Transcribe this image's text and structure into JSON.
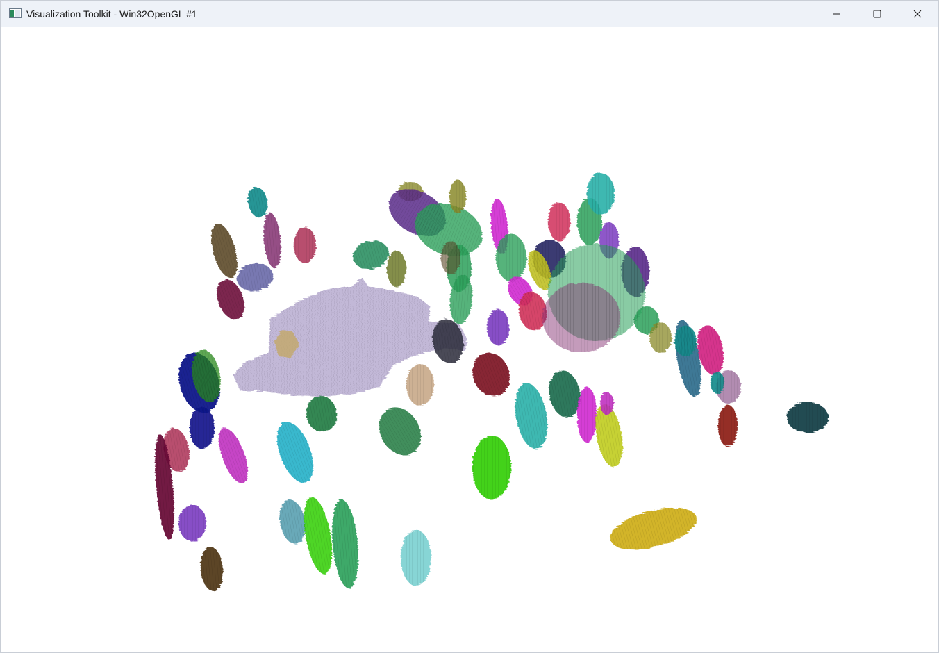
{
  "window": {
    "title": "Visualization Toolkit - Win32OpenGL #1",
    "background": "#ffffff",
    "titlebar_color": "#eef2f8"
  },
  "controls": {
    "minimize_icon": "minimize-icon",
    "maximize_icon": "maximize-icon",
    "close_icon": "close-icon"
  },
  "scene": {
    "description_type": "3d-render",
    "main_body_color": "#b7abd0",
    "palette": [
      "#138a8a",
      "#5c4a2a",
      "#8a3a78",
      "#b03a5e",
      "#6a6aa8",
      "#6e0d3c",
      "#1c8a5a",
      "#6e7a2a",
      "#8a8a2a",
      "#5a2a8a",
      "#2aa05a",
      "#d02ad0",
      "#1a1a5a",
      "#c0c022",
      "#d0305a",
      "#2ab0a8",
      "#7a3ac0",
      "#7a1020",
      "#c8a888",
      "#2a2a3a",
      "#1e7a40",
      "#22b0c8",
      "#10138a",
      "#2a8a1a",
      "#3ad010",
      "#1a6a4a",
      "#c0cc20",
      "#c030c0",
      "#6a0a3a",
      "#4a3010",
      "#5aa0b0",
      "#7ad0d0",
      "#d0b020",
      "#14404a",
      "#8a1a10",
      "#d02080",
      "#2a6a8a",
      "#aa80a8"
    ]
  }
}
